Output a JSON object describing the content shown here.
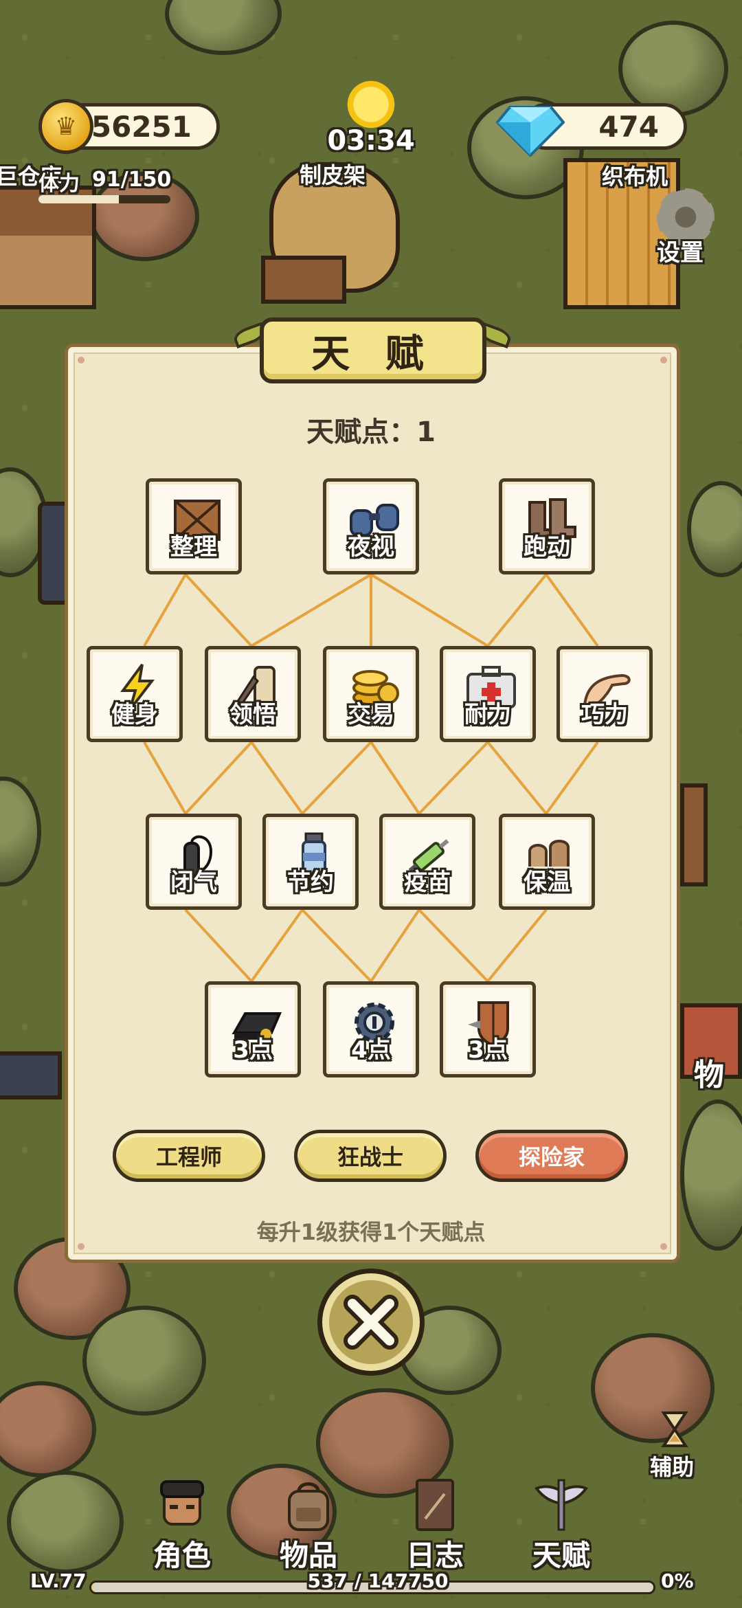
{
  "hud": {
    "coins": "56251",
    "gems": "474",
    "clock": "03:34",
    "stamina_label": "体力",
    "stamina_value": "91/150",
    "stamina_fraction": 0.61,
    "settings_label": "设置"
  },
  "world_labels": {
    "warehouse": "巨仓库",
    "tannery": "制皮架",
    "loom": "织布机",
    "items_side": "物"
  },
  "panel": {
    "title": "天 赋",
    "points_label": "天赋点：",
    "points_value": "1",
    "hint": "每升1级获得1个天赋点"
  },
  "talents": {
    "row1": [
      {
        "label": "整理",
        "icon": "crate-icon"
      },
      {
        "label": "夜视",
        "icon": "binoculars-icon"
      },
      {
        "label": "跑动",
        "icon": "boots-icon"
      }
    ],
    "row2": [
      {
        "label": "健身",
        "icon": "lightning-icon"
      },
      {
        "label": "领悟",
        "icon": "scroll-quill-icon"
      },
      {
        "label": "交易",
        "icon": "coins-icon"
      },
      {
        "label": "耐力",
        "icon": "first-aid-kit-icon"
      },
      {
        "label": "巧力",
        "icon": "hand-icon"
      }
    ],
    "row3": [
      {
        "label": "闭气",
        "icon": "oxygen-tank-icon"
      },
      {
        "label": "节约",
        "icon": "bottle-icon"
      },
      {
        "label": "疫苗",
        "icon": "syringe-icon"
      },
      {
        "label": "保温",
        "icon": "fur-gloves-icon"
      }
    ],
    "row4": [
      {
        "label": "3点",
        "icon": "ingot-icon"
      },
      {
        "label": "4点",
        "icon": "gear-lock-icon"
      },
      {
        "label": "3点",
        "icon": "shield-icon"
      }
    ]
  },
  "classes": [
    {
      "label": "工程师",
      "color": "#eedd86"
    },
    {
      "label": "狂战士",
      "color": "#eedd86"
    },
    {
      "label": "探险家",
      "color": "#e07b58"
    }
  ],
  "nav": {
    "items": [
      {
        "label": "角色",
        "icon": "character-icon"
      },
      {
        "label": "物品",
        "icon": "backpack-icon"
      },
      {
        "label": "日志",
        "icon": "journal-icon"
      },
      {
        "label": "天赋",
        "icon": "winged-sword-icon"
      }
    ],
    "assist_label": "辅助",
    "level": "LV.77",
    "xp_text": "537 / 147750",
    "xp_percent": "0%"
  }
}
